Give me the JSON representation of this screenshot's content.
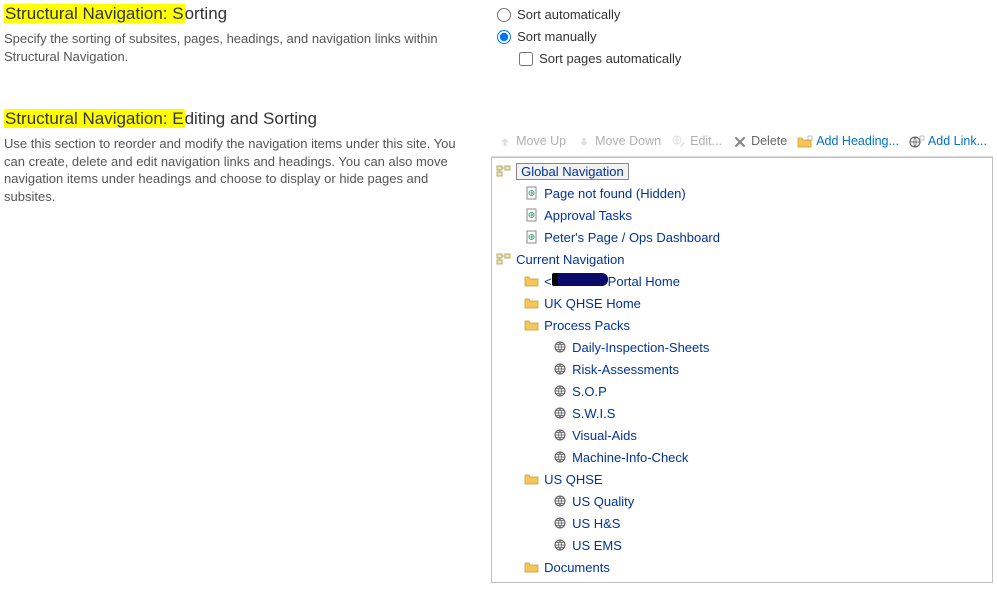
{
  "section_sort": {
    "title_hl": "Structural Navigation: S",
    "title_rest": "orting",
    "desc": "Specify the sorting of subsites, pages, headings, and navigation links within Structural Navigation."
  },
  "section_edit": {
    "title_hl": "Structural Navigation: E",
    "title_rest": "diting and Sorting",
    "desc": "Use this section to reorder and modify the navigation items under this site. You can create, delete and edit navigation links and headings. You can also move navigation items under headings and choose to display or hide pages and subsites."
  },
  "sort": {
    "auto": "Sort automatically",
    "manual": "Sort manually",
    "pages_auto": "Sort pages automatically"
  },
  "toolbar": {
    "move_up": "Move\nUp",
    "move_down": "Move\nDown",
    "edit": "Edit...",
    "delete": "Delete",
    "add_heading": "Add\nHeading...",
    "add_link": "Add\nLink..."
  },
  "tree": {
    "global_nav": "Global Navigation",
    "page_not_found": "Page not found (Hidden)",
    "approval": "Approval Tasks",
    "peters": "Peter's Page / Ops Dashboard",
    "current_nav": "Current Navigation",
    "portal_home_prefix": "<",
    "portal_home_suffix": "Portal Home",
    "uk_qhse": "UK QHSE Home",
    "process_packs": "Process Packs",
    "daily_inspection": "Daily-Inspection-Sheets",
    "risk": "Risk-Assessments",
    "sop": "S.O.P",
    "swis": "S.W.I.S",
    "visual_aids": "Visual-Aids",
    "machine_info": "Machine-Info-Check",
    "us_qhse": "US QHSE",
    "us_quality": "US Quality",
    "us_hs": "US H&S",
    "us_ems": "US EMS",
    "documents": "Documents"
  }
}
